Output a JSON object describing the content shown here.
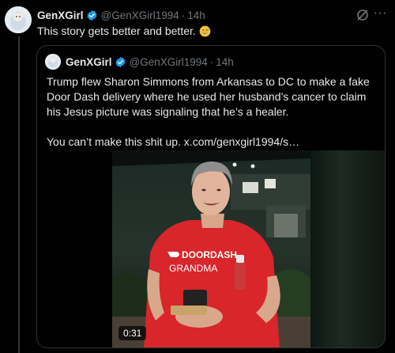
{
  "post": {
    "author_name": "GenXGirl",
    "author_handle": "@GenXGirl1994",
    "separator": "·",
    "time": "14h",
    "text": "This story gets better and better.",
    "emoji": "grinning-sweat-emoji",
    "more_label": "···"
  },
  "quote": {
    "author_name": "GenXGirl",
    "author_handle": "@GenXGirl1994",
    "separator": "·",
    "time": "14h",
    "paragraph1": "Trump flew Sharon Simmons from Arkansas to DC to make a fake Door Dash delivery where he used her husband’s cancer to claim his Jesus picture was signaling that he’s a healer.",
    "paragraph2": "You can’t make this shit up.  x.com/genxgirl1994/s…",
    "video": {
      "duration": "0:31",
      "shirt_line1": "DOORDASH",
      "shirt_line2": "GRANDMA"
    }
  },
  "colors": {
    "background": "#000000",
    "text_primary": "#e7e9ea",
    "text_secondary": "#71767b",
    "verified_blue": "#1d9bf0",
    "border": "#2f3336",
    "shirt_red": "#d8262a"
  }
}
